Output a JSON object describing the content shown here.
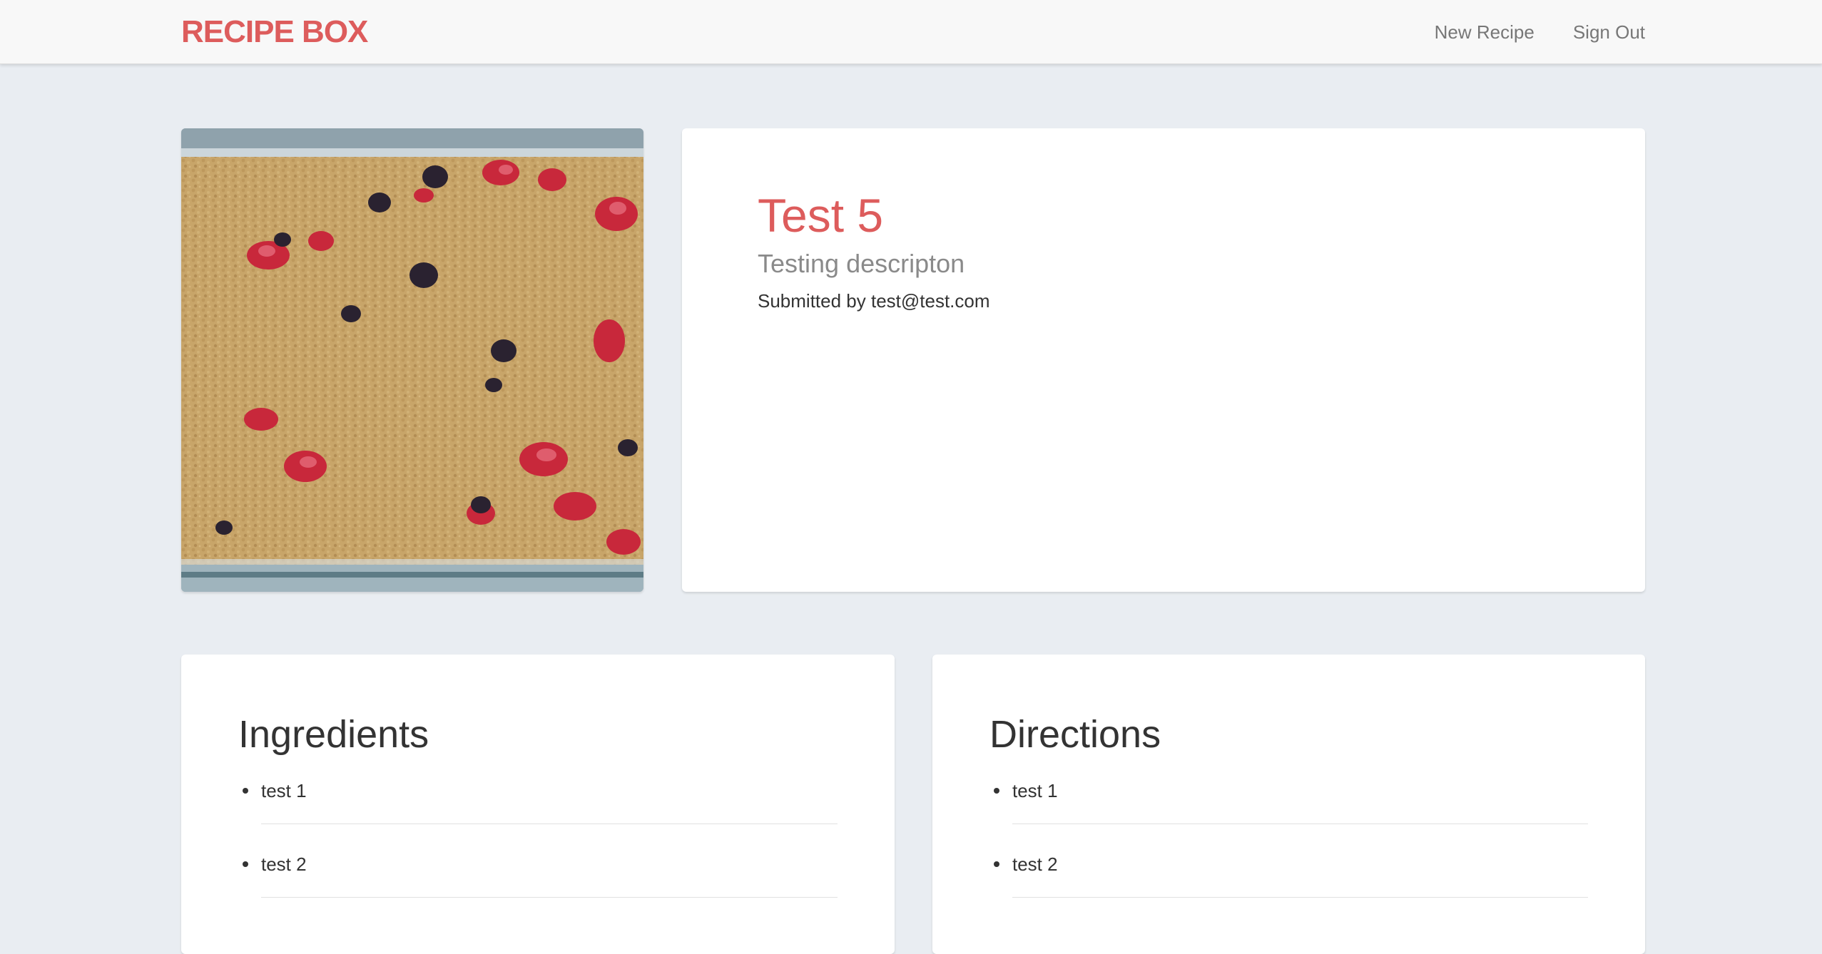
{
  "navbar": {
    "brand": "RECIPE BOX",
    "links": {
      "new_recipe": "New Recipe",
      "sign_out": "Sign Out"
    }
  },
  "recipe": {
    "title": "Test 5",
    "description": "Testing descripton",
    "submitted_by": "Submitted by test@test.com",
    "image_description": "Baked berry crumble in a glass dish"
  },
  "ingredients": {
    "heading": "Ingredients",
    "items": [
      "test 1",
      "test 2"
    ]
  },
  "directions": {
    "heading": "Directions",
    "items": [
      "test 1",
      "test 2"
    ]
  },
  "colors": {
    "brand": "#dd5c5c",
    "background": "#e9edf2",
    "navbar": "#f8f8f8",
    "card": "#ffffff"
  }
}
